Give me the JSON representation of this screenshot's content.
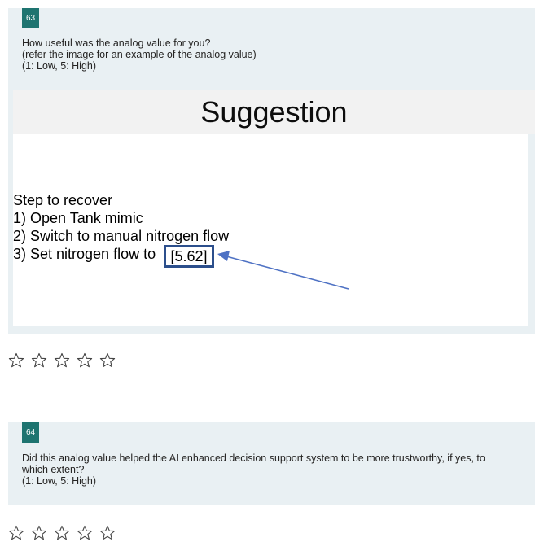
{
  "questions": [
    {
      "number": "63",
      "lines": [
        "How useful was the analog value for you?",
        "(refer the image for an example of the analog value)",
        "(1: Low, 5: High)"
      ],
      "image": {
        "title": "Suggestion",
        "steps": [
          "Step to recover",
          "1) Open Tank mimic",
          "2) Switch to manual nitrogen flow",
          "3) Set nitrogen flow to"
        ],
        "analog_value": "[5.62]"
      },
      "rating_max": 5,
      "rating_value": 0
    },
    {
      "number": "64",
      "lines": [
        "Did this analog value helped the AI enhanced decision support system to be more trustworthy, if yes, to which extent?",
        "(1: Low, 5: High)"
      ],
      "rating_max": 5,
      "rating_value": 0
    }
  ],
  "colors": {
    "card_bg": "#e9f0f3",
    "number_badge_bg": "#1e7470",
    "highlight_border": "#2c4f8c",
    "arrow": "#4f72c4"
  },
  "icons": {
    "rating": "star-outline-icon"
  }
}
